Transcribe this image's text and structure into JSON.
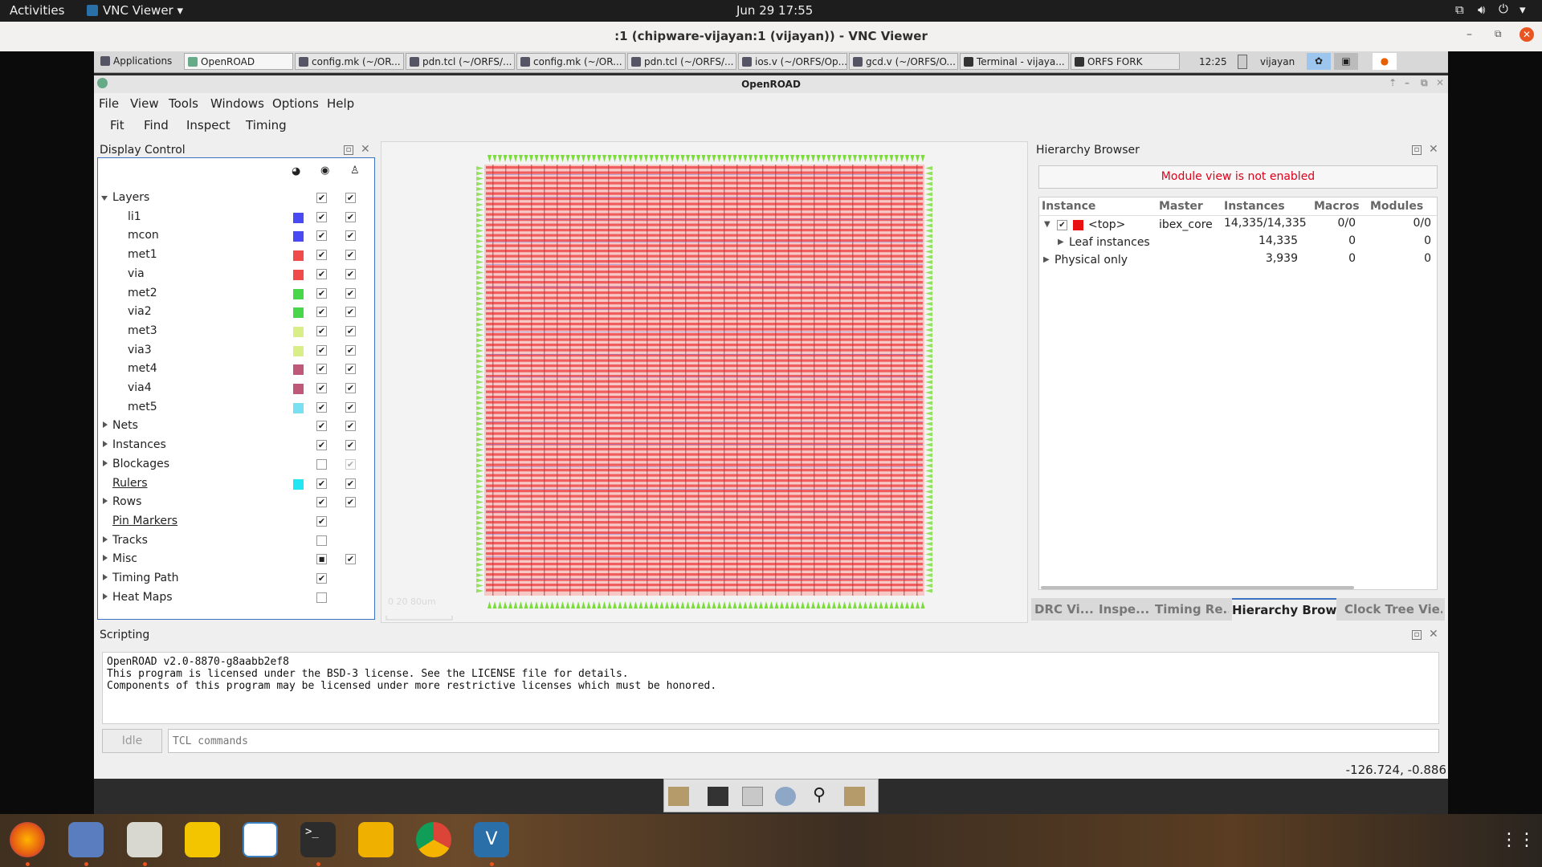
{
  "gnome": {
    "activities": "Activities",
    "app_name": "VNC Viewer",
    "clock": "Jun 29  17:55"
  },
  "vnc": {
    "title": ":1 (chipware-vijayan:1 (vijayan)) - VNC Viewer"
  },
  "xfce_panel": {
    "applications": "Applications",
    "tasks": [
      "OpenROAD",
      "config.mk (~/OR...",
      "pdn.tcl (~/ORFS/...",
      "config.mk (~/OR...",
      "pdn.tcl (~/ORFS/...",
      "ios.v (~/ORFS/Op...",
      "gcd.v (~/ORFS/O...",
      "Terminal - vijaya...",
      "ORFS FORK"
    ],
    "clock": "12:25",
    "user": "vijayan"
  },
  "openroad": {
    "title": "OpenROAD",
    "menu": [
      "File",
      "View",
      "Tools",
      "Windows",
      "Options",
      "Help"
    ],
    "toolbar": [
      "Fit",
      "Find",
      "Inspect",
      "Timing"
    ]
  },
  "display_control": {
    "title": "Display Control",
    "rows": [
      {
        "label": "Layers",
        "indent": 0,
        "expander": "open",
        "color": "",
        "visible": "checked",
        "selectable": "checked",
        "link": false
      },
      {
        "label": "li1",
        "indent": 1,
        "expander": "",
        "color": "#4a4af5",
        "visible": "checked",
        "selectable": "checked",
        "link": false
      },
      {
        "label": "mcon",
        "indent": 1,
        "expander": "",
        "color": "#4a4af5",
        "visible": "checked",
        "selectable": "checked",
        "link": false
      },
      {
        "label": "met1",
        "indent": 1,
        "expander": "",
        "color": "#f04a4a",
        "visible": "checked",
        "selectable": "checked",
        "link": false
      },
      {
        "label": "via",
        "indent": 1,
        "expander": "",
        "color": "#f04a4a",
        "visible": "checked",
        "selectable": "checked",
        "link": false
      },
      {
        "label": "met2",
        "indent": 1,
        "expander": "",
        "color": "#4ad64a",
        "visible": "checked",
        "selectable": "checked",
        "link": false
      },
      {
        "label": "via2",
        "indent": 1,
        "expander": "",
        "color": "#4ad64a",
        "visible": "checked",
        "selectable": "checked",
        "link": false
      },
      {
        "label": "met3",
        "indent": 1,
        "expander": "",
        "color": "#d9ee86",
        "visible": "checked",
        "selectable": "checked",
        "link": false
      },
      {
        "label": "via3",
        "indent": 1,
        "expander": "",
        "color": "#d9ee86",
        "visible": "checked",
        "selectable": "checked",
        "link": false
      },
      {
        "label": "met4",
        "indent": 1,
        "expander": "",
        "color": "#c0587a",
        "visible": "checked",
        "selectable": "checked",
        "link": false
      },
      {
        "label": "via4",
        "indent": 1,
        "expander": "",
        "color": "#c0587a",
        "visible": "checked",
        "selectable": "checked",
        "link": false
      },
      {
        "label": "met5",
        "indent": 1,
        "expander": "",
        "color": "#78e0f0",
        "visible": "checked",
        "selectable": "checked",
        "link": false
      },
      {
        "label": "Nets",
        "indent": 0,
        "expander": "closed",
        "color": "",
        "visible": "checked",
        "selectable": "checked",
        "link": false
      },
      {
        "label": "Instances",
        "indent": 0,
        "expander": "closed",
        "color": "",
        "visible": "checked",
        "selectable": "checked",
        "link": false
      },
      {
        "label": "Blockages",
        "indent": 0,
        "expander": "closed",
        "color": "",
        "visible": "unchecked",
        "selectable": "disabled",
        "link": false
      },
      {
        "label": "Rulers",
        "indent": 0,
        "expander": "",
        "color": "#22e6f2",
        "visible": "checked",
        "selectable": "checked",
        "link": true
      },
      {
        "label": "Rows",
        "indent": 0,
        "expander": "closed",
        "color": "",
        "visible": "checked",
        "selectable": "checked",
        "link": false
      },
      {
        "label": "Pin Markers",
        "indent": 0,
        "expander": "",
        "color": "",
        "visible": "checked",
        "selectable": "none",
        "link": true
      },
      {
        "label": "Tracks",
        "indent": 0,
        "expander": "closed",
        "color": "",
        "visible": "unchecked",
        "selectable": "none",
        "link": false
      },
      {
        "label": "Misc",
        "indent": 0,
        "expander": "closed",
        "color": "",
        "visible": "partial",
        "selectable": "checked",
        "link": false
      },
      {
        "label": "Timing Path",
        "indent": 0,
        "expander": "closed",
        "color": "",
        "visible": "checked",
        "selectable": "none",
        "link": false
      },
      {
        "label": "Heat Maps",
        "indent": 0,
        "expander": "closed",
        "color": "",
        "visible": "unchecked",
        "selectable": "none",
        "link": false
      }
    ]
  },
  "layout": {
    "scale_label": "0 20 80um"
  },
  "hierarchy": {
    "title": "Hierarchy Browser",
    "module_view_msg": "Module view is not enabled",
    "columns": [
      "Instance",
      "Master",
      "Instances",
      "Macros",
      "Modules"
    ],
    "rows": [
      {
        "instance": "<top>",
        "master": "ibex_core",
        "instances": "14,335/14,335",
        "macros": "0/0",
        "modules": "0/0"
      },
      {
        "instance": "Leaf instances",
        "master": "",
        "instances": "14,335",
        "macros": "0",
        "modules": "0"
      },
      {
        "instance": "Physical only",
        "master": "",
        "instances": "3,939",
        "macros": "0",
        "modules": "0"
      }
    ],
    "tabs": [
      "DRC Vi...",
      "Inspe...",
      "Timing Re...",
      "Hierarchy Brow...",
      "Clock Tree Vie..."
    ],
    "active_tab": 3
  },
  "scripting": {
    "title": "Scripting",
    "output": "OpenROAD v2.0-8870-g8aabb2ef8\nThis program is licensed under the BSD-3 license. See the LICENSE file for details.\nComponents of this program may be licensed under more restrictive licenses which must be honored.",
    "idle": "Idle",
    "placeholder": "TCL commands"
  },
  "status": {
    "coords": "-126.724, -0.886"
  },
  "colors": {
    "met1": "#f04a4a",
    "pin": "#7cdc3c",
    "module_msg": "#e0001a",
    "top_marker": "#e81010"
  }
}
